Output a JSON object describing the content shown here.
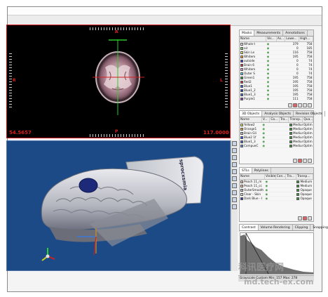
{
  "view2d": {
    "orient_top": "A",
    "orient_left": "R",
    "orient_right": "L",
    "orient_bottom": "P",
    "value_left": "54.5657",
    "value_right": "117.0000"
  },
  "models_panel": {
    "tabs": [
      "Masks",
      "Measurements",
      "Annotations"
    ],
    "columns": [
      "Name",
      "Vis...",
      "As...",
      "Lowe...",
      "High..."
    ],
    "rows": [
      {
        "name": "Whole t",
        "color": "#e8e8e8",
        "low": "379",
        "high": "758"
      },
      {
        "name": "air",
        "color": "#7ad46a",
        "low": "0",
        "high": "185"
      },
      {
        "name": "Skin Le",
        "color": "#e6e36a",
        "low": "116",
        "high": "758"
      },
      {
        "name": "Whitem",
        "color": "#f0a030",
        "low": "195",
        "high": "758"
      },
      {
        "name": "outside",
        "color": "#3a3ab8",
        "low": "0",
        "high": "74"
      },
      {
        "name": "Brain 6",
        "color": "#c03a3a",
        "low": "0",
        "high": "74"
      },
      {
        "name": "Whitem",
        "color": "#e08ae0",
        "low": "0",
        "high": "74"
      },
      {
        "name": "Outer S",
        "color": "#60c0e0",
        "low": "0",
        "high": "74"
      },
      {
        "name": "Green1",
        "color": "#3a9a3a",
        "low": "195",
        "high": "758"
      },
      {
        "name": "Red2",
        "color": "#d03030",
        "low": "195",
        "high": "758"
      },
      {
        "name": "Blue1",
        "color": "#3060d0",
        "low": "195",
        "high": "758"
      },
      {
        "name": "Blue1_2",
        "color": "#2a40a8",
        "low": "195",
        "high": "758"
      },
      {
        "name": "Blue1_3",
        "color": "#4060c0",
        "low": "195",
        "high": "758"
      },
      {
        "name": "Purple1",
        "color": "#8a3ab0",
        "low": "111",
        "high": "758"
      }
    ]
  },
  "objects_panel": {
    "tabs": [
      "3D Objects",
      "Analysis Objects",
      "Revision Objects"
    ],
    "columns": [
      "Name",
      "V...",
      "Co...",
      "Tra...",
      "Transp...",
      "Qua..."
    ],
    "rows": [
      {
        "name": "Yellow2",
        "color": "#e6e36a",
        "quality": "Medium",
        "opt": "Optim"
      },
      {
        "name": "Orange1",
        "color": "#f0a030",
        "quality": "Medium",
        "opt": "Optim"
      },
      {
        "name": "Brain Gli",
        "color": "#c0c0c0",
        "quality": "Medium",
        "opt": "Optim"
      },
      {
        "name": "Blue2 1f",
        "color": "#3060d0",
        "quality": "Medium",
        "opt": "Optim"
      },
      {
        "name": "Blue1_3",
        "color": "#4060c0",
        "quality": "Medium",
        "opt": "Optim"
      },
      {
        "name": "CompueC",
        "color": "#5a8ad0",
        "quality": "Medium",
        "opt": "Optim"
      }
    ]
  },
  "stl_panel": {
    "tabs": [
      "STLs",
      "Polylines"
    ],
    "columns": [
      "Name",
      "Visible",
      "Con...",
      "Tra...",
      "Transp..."
    ],
    "rows": [
      {
        "name": "Peach 11_m",
        "color": "#f0c0a0",
        "value": "Medium"
      },
      {
        "name": "Peach 11_cc",
        "color": "#f0c0a0",
        "value": "Medium"
      },
      {
        "name": "OuterSmooth",
        "color": "#c0c0c0",
        "value": "Opaque"
      },
      {
        "name": "Clear - Skin",
        "color": "#e0e0e0",
        "value": "Opaque"
      },
      {
        "name": "Dark Blue - I",
        "color": "#2a40a8",
        "value": "Opaque"
      }
    ]
  },
  "contrast_panel": {
    "tabs": [
      "Contrast",
      "Volume Rendering",
      "Clipping",
      "Snapping"
    ]
  },
  "statusbar": "Grayscale  Custom   Min: 157   Max: 278",
  "watermark": {
    "cn": "科讯医疗网",
    "url": "md.tech-ex.com"
  },
  "device_label": "sprocxsmia"
}
